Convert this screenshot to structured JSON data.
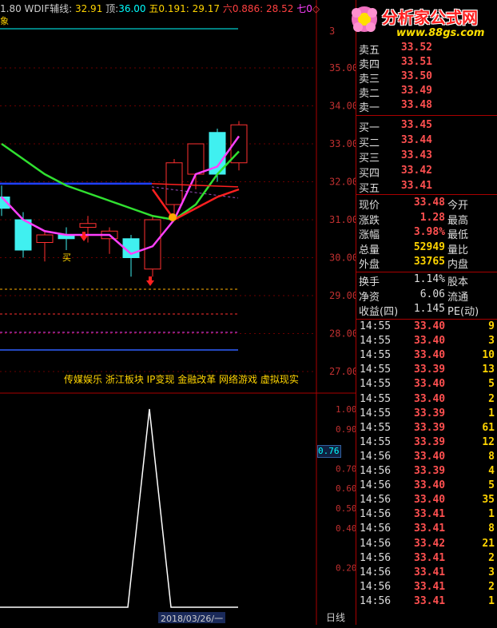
{
  "indicator_header": {
    "prefix": "1.80",
    "name": "WDIF辅线:",
    "name_value": "32.91",
    "top_label": "顶:",
    "top_value": "36.00",
    "five_label": "五",
    "five_value": "0.191: 29.17",
    "six_label": "六",
    "six_value": "0.886: 28.52",
    "seven_label": "七0",
    "sub_label": "象"
  },
  "price_axis": [
    "35.00",
    "34.00",
    "33.00",
    "32.00",
    "31.00",
    "30.00",
    "29.00",
    "28.00",
    "27.00"
  ],
  "price_axis_top": "3",
  "sector_tags": "传媒娱乐 浙江板块 IP变现 金融改革 网络游戏 虚拟现实",
  "buy_marker": "买",
  "sub_axis": [
    "1.00",
    "0.90",
    "0.70",
    "0.60",
    "0.50",
    "0.40",
    "0.20"
  ],
  "sub_value_box": "0.76",
  "date_label": "2018/03/26/一",
  "period_label": "日线",
  "logo": {
    "title": "分析家公式网",
    "url": "www.88gs.com"
  },
  "order_book": {
    "asks": [
      {
        "label": "卖五",
        "price": "33.52"
      },
      {
        "label": "卖四",
        "price": "33.51"
      },
      {
        "label": "卖三",
        "price": "33.50"
      },
      {
        "label": "卖二",
        "price": "33.49"
      },
      {
        "label": "卖一",
        "price": "33.48"
      }
    ],
    "bids": [
      {
        "label": "买一",
        "price": "33.45"
      },
      {
        "label": "买二",
        "price": "33.44"
      },
      {
        "label": "买三",
        "price": "33.43"
      },
      {
        "label": "买四",
        "price": "33.42"
      },
      {
        "label": "买五",
        "price": "33.41"
      }
    ]
  },
  "stats": [
    {
      "label": "现价",
      "value": "33.48",
      "right": "今开"
    },
    {
      "label": "涨跌",
      "value": "1.28",
      "right": "最高"
    },
    {
      "label": "涨幅",
      "value": "3.98%",
      "right": "最低"
    },
    {
      "label": "总量",
      "value": "52949",
      "right": "量比"
    },
    {
      "label": "外盘",
      "value": "33765",
      "right": "内盘"
    }
  ],
  "fundamentals": [
    {
      "label": "换手",
      "value": "1.14%",
      "right": "股本"
    },
    {
      "label": "净资",
      "value": "6.06",
      "right": "流通"
    },
    {
      "label": "收益(四)",
      "value": "1.145",
      "right": "PE(动)"
    }
  ],
  "ticks": [
    {
      "time": "14:55",
      "price": "33.40",
      "vol": "9"
    },
    {
      "time": "14:55",
      "price": "33.40",
      "vol": "3"
    },
    {
      "time": "14:55",
      "price": "33.40",
      "vol": "10"
    },
    {
      "time": "14:55",
      "price": "33.39",
      "vol": "13"
    },
    {
      "time": "14:55",
      "price": "33.40",
      "vol": "5"
    },
    {
      "time": "14:55",
      "price": "33.40",
      "vol": "2"
    },
    {
      "time": "14:55",
      "price": "33.39",
      "vol": "1"
    },
    {
      "time": "14:55",
      "price": "33.39",
      "vol": "61"
    },
    {
      "time": "14:55",
      "price": "33.39",
      "vol": "12"
    },
    {
      "time": "14:56",
      "price": "33.40",
      "vol": "8"
    },
    {
      "time": "14:56",
      "price": "33.39",
      "vol": "4"
    },
    {
      "time": "14:56",
      "price": "33.40",
      "vol": "5"
    },
    {
      "time": "14:56",
      "price": "33.40",
      "vol": "35"
    },
    {
      "time": "14:56",
      "price": "33.41",
      "vol": "1"
    },
    {
      "time": "14:56",
      "price": "33.41",
      "vol": "8"
    },
    {
      "time": "14:56",
      "price": "33.42",
      "vol": "21"
    },
    {
      "time": "14:56",
      "price": "33.41",
      "vol": "2"
    },
    {
      "time": "14:56",
      "price": "33.41",
      "vol": "3"
    },
    {
      "time": "14:56",
      "price": "33.41",
      "vol": "2"
    },
    {
      "time": "14:56",
      "price": "33.41",
      "vol": "1"
    }
  ],
  "chart_data": {
    "type": "candlestick",
    "candles": [
      {
        "o": 31.6,
        "h": 31.9,
        "l": 31.1,
        "c": 31.3,
        "bull": false
      },
      {
        "o": 31.0,
        "h": 31.2,
        "l": 30.0,
        "c": 30.2,
        "bull": false
      },
      {
        "o": 30.4,
        "h": 30.7,
        "l": 29.9,
        "c": 30.6,
        "bull": true
      },
      {
        "o": 30.6,
        "h": 30.8,
        "l": 30.2,
        "c": 30.5,
        "bull": false
      },
      {
        "o": 30.8,
        "h": 31.1,
        "l": 30.4,
        "c": 30.9,
        "bull": true
      },
      {
        "o": 30.5,
        "h": 30.8,
        "l": 30.1,
        "c": 30.7,
        "bull": true
      },
      {
        "o": 30.5,
        "h": 30.6,
        "l": 29.5,
        "c": 30.0,
        "bull": false
      },
      {
        "o": 29.7,
        "h": 31.1,
        "l": 29.5,
        "c": 31.0,
        "bull": true
      },
      {
        "o": 31.4,
        "h": 32.6,
        "l": 31.1,
        "c": 32.5,
        "bull": true
      },
      {
        "o": 32.2,
        "h": 33.0,
        "l": 31.8,
        "c": 33.0,
        "bull": true
      },
      {
        "o": 33.3,
        "h": 33.4,
        "l": 32.0,
        "c": 32.2,
        "bull": false
      },
      {
        "o": 32.5,
        "h": 33.6,
        "l": 32.3,
        "c": 33.5,
        "bull": true
      }
    ],
    "ma_green": [
      33.0,
      32.6,
      32.2,
      31.9,
      31.7,
      31.5,
      31.3,
      31.1,
      31.0,
      31.4,
      32.2,
      32.8
    ],
    "ma_magenta": [
      31.6,
      31.0,
      30.7,
      30.6,
      30.6,
      30.6,
      30.1,
      30.3,
      31.0,
      32.2,
      32.4,
      33.2
    ],
    "ma_red": [
      null,
      null,
      null,
      null,
      null,
      null,
      null,
      31.8,
      31.0,
      31.3,
      31.6,
      31.8
    ],
    "ma_blue_level": 31.95,
    "sub_series": [
      0,
      0,
      0,
      0,
      0,
      0,
      1.0,
      0,
      0,
      0
    ]
  }
}
